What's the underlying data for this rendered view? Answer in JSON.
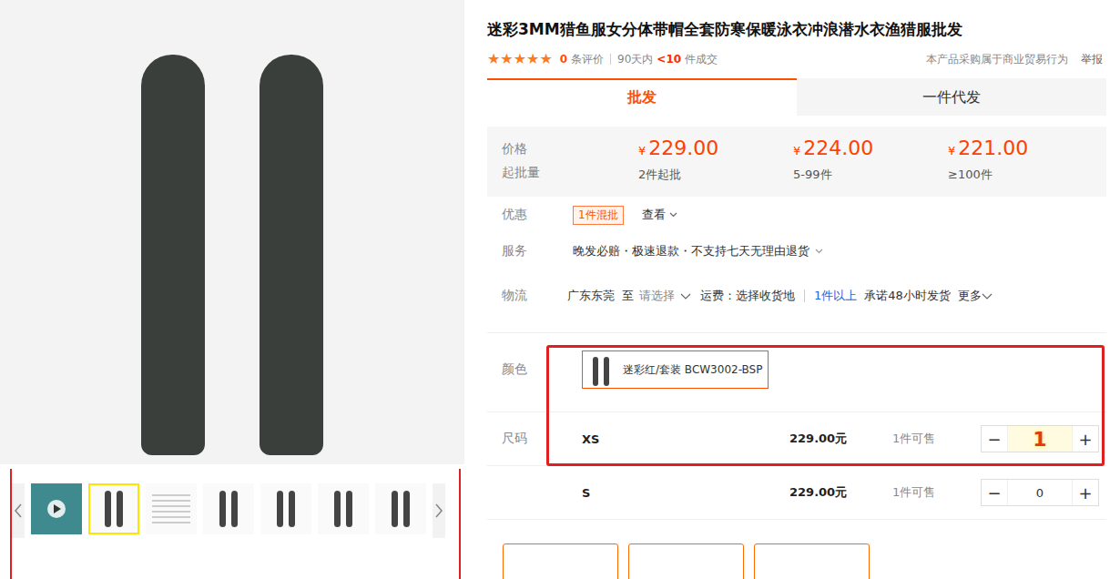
{
  "gallery": {
    "thumbnails": [
      {
        "kind": "video",
        "selected": false
      },
      {
        "kind": "photo",
        "selected": true
      },
      {
        "kind": "chart",
        "selected": false
      },
      {
        "kind": "photo",
        "selected": false
      },
      {
        "kind": "photo",
        "selected": false
      },
      {
        "kind": "photo",
        "selected": false
      },
      {
        "kind": "photo",
        "selected": false
      }
    ]
  },
  "product": {
    "title": "迷彩3MM猎鱼服女分体带帽全套防寒保暖泳衣冲浪潜水衣渔猎服批发",
    "stars": 5,
    "review_count": "0",
    "review_label": "条评价",
    "sales_period": "90天内",
    "sales_count": "<10",
    "sales_label": "件成交",
    "notice": "本产品采购属于商业贸易行为",
    "report": "举报"
  },
  "tabs": [
    {
      "label": "批发",
      "selected": true
    },
    {
      "label": "一件代发",
      "selected": false
    }
  ],
  "price_table": {
    "price_label": "价格",
    "moq_label": "起批量",
    "currency": "¥",
    "tiers": [
      {
        "price": "229.00",
        "moq": "2件起批"
      },
      {
        "price": "224.00",
        "moq": "5-99件"
      },
      {
        "price": "221.00",
        "moq": "≥100件"
      }
    ]
  },
  "promotion": {
    "label": "优惠",
    "tag": "1件混批",
    "link": "查看"
  },
  "service": {
    "label": "服务",
    "text": "晚发必赔・极速退款・不支持七天无理由退货"
  },
  "logistics": {
    "label": "物流",
    "origin": "广东东莞",
    "to": "至",
    "destination": "请选择",
    "freight": "运费：选择收货地",
    "min_qty": "1件以上",
    "promise": "承诺48小时发货",
    "more": "更多"
  },
  "color": {
    "label": "颜色",
    "options": [
      {
        "label": "迷彩红/套装 BCW3002-BSP",
        "selected": true
      }
    ]
  },
  "size": {
    "label": "尺码",
    "minus": "−",
    "plus": "+",
    "rows": [
      {
        "size": "XS",
        "price": "229.00元",
        "stock": "1件可售",
        "quantity": "1",
        "highlighted": true
      },
      {
        "size": "S",
        "price": "229.00元",
        "stock": "1件可售",
        "quantity": "0",
        "highlighted": false
      }
    ]
  },
  "annotation": {
    "box_shown": true
  }
}
